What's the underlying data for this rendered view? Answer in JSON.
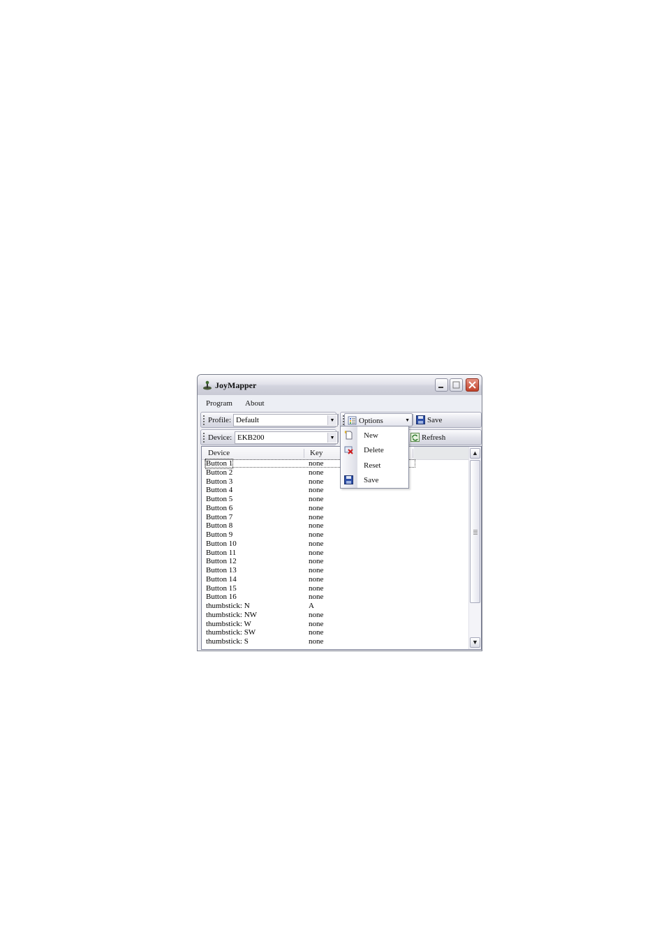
{
  "window": {
    "title": "JoyMapper"
  },
  "menu": {
    "items": [
      "Program",
      "About"
    ]
  },
  "toolbar_profile": {
    "label": "Profile:",
    "combo_value": "Default",
    "options_label": "Options",
    "save_label": "Save"
  },
  "toolbar_device": {
    "label": "Device:",
    "combo_value": "EKB200",
    "refresh_label": "Refresh"
  },
  "options_menu": {
    "items": [
      {
        "label": "New",
        "icon": "new-document-icon"
      },
      {
        "label": "Delete",
        "icon": "delete-icon"
      },
      {
        "label": "Reset",
        "icon": ""
      },
      {
        "label": "Save",
        "icon": "floppy-disk-icon"
      }
    ]
  },
  "list": {
    "columns": [
      "Device",
      "Key"
    ],
    "rows": [
      {
        "device": "Button 1",
        "key": "none"
      },
      {
        "device": "Button 2",
        "key": "none"
      },
      {
        "device": "Button 3",
        "key": "none"
      },
      {
        "device": "Button 4",
        "key": "none"
      },
      {
        "device": "Button 5",
        "key": "none"
      },
      {
        "device": "Button 6",
        "key": "none"
      },
      {
        "device": "Button 7",
        "key": "none"
      },
      {
        "device": "Button 8",
        "key": "none"
      },
      {
        "device": "Button 9",
        "key": "none"
      },
      {
        "device": "Button 10",
        "key": "none"
      },
      {
        "device": "Button 11",
        "key": "none"
      },
      {
        "device": "Button 12",
        "key": "none"
      },
      {
        "device": "Button 13",
        "key": "none"
      },
      {
        "device": "Button 14",
        "key": "none"
      },
      {
        "device": "Button 15",
        "key": "none"
      },
      {
        "device": "Button 16",
        "key": "none"
      },
      {
        "device": "thumbstick: N",
        "key": "A"
      },
      {
        "device": "thumbstick: NW",
        "key": "none"
      },
      {
        "device": "thumbstick: W",
        "key": "none"
      },
      {
        "device": "thumbstick: SW",
        "key": "none"
      },
      {
        "device": "thumbstick: S",
        "key": "none"
      }
    ]
  }
}
